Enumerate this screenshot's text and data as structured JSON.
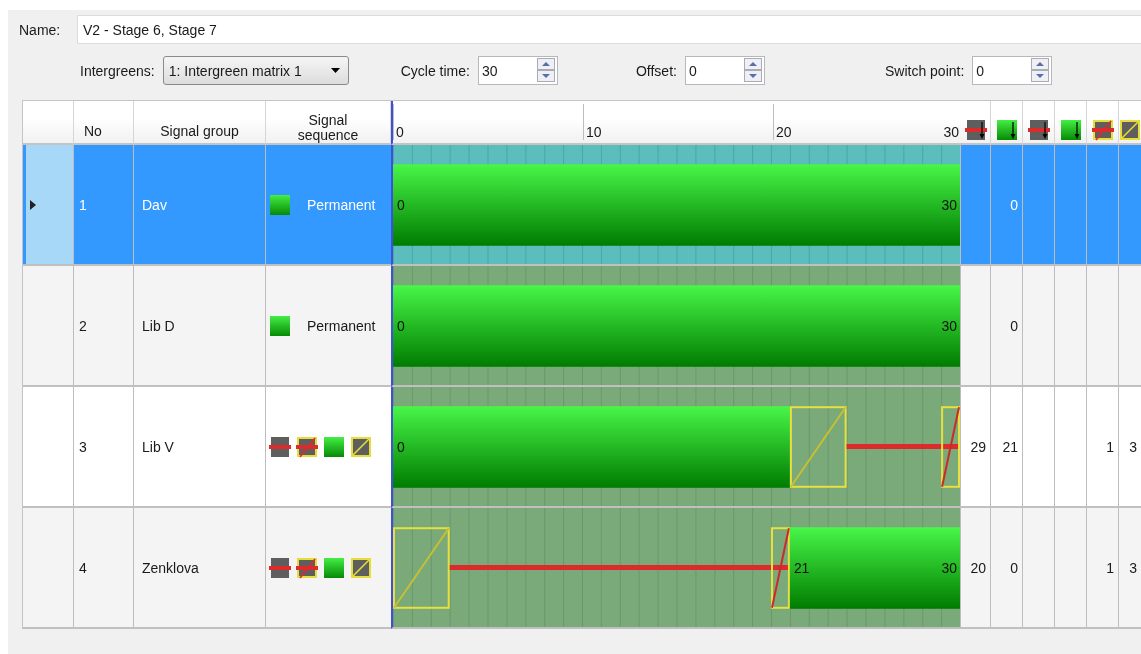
{
  "name_field": {
    "label": "Name:",
    "value": "V2 - Stage 6, Stage 7"
  },
  "controls": [
    {
      "kind": "dropdown",
      "label": "Intergreens:",
      "value": "1: Intergreen matrix 1"
    },
    {
      "kind": "spin",
      "label": "Cycle time:",
      "value": "30"
    },
    {
      "kind": "spin",
      "label": "Offset:",
      "value": "0"
    },
    {
      "kind": "spin",
      "label": "Switch point:",
      "value": "0"
    }
  ],
  "table": {
    "columns": [
      "No",
      "Signal group",
      "Signal sequence"
    ],
    "scale": [
      "0",
      "10",
      "20",
      "30"
    ],
    "extra_columns": [
      {
        "kind": "red-end"
      },
      {
        "kind": "green-end"
      },
      {
        "kind": "red-end"
      },
      {
        "kind": "green-end"
      },
      {
        "kind": "red-amber"
      },
      {
        "kind": "amber"
      }
    ],
    "rows": [
      {
        "no": "1",
        "name": "Dav",
        "selected": true,
        "sequence": {
          "kind": "permanent",
          "label": "Permanent",
          "icons": [
            {
              "kind": "green"
            }
          ]
        },
        "steps": [
          {
            "kind": "green",
            "label_start": "0"
          },
          {
            "kind": "green"
          },
          {
            "kind": "green"
          },
          {
            "kind": "green"
          },
          {
            "kind": "green"
          },
          {
            "kind": "green"
          },
          {
            "kind": "green"
          },
          {
            "kind": "green"
          },
          {
            "kind": "green"
          },
          {
            "kind": "green"
          },
          {
            "kind": "green"
          },
          {
            "kind": "green"
          },
          {
            "kind": "green"
          },
          {
            "kind": "green"
          },
          {
            "kind": "green"
          },
          {
            "kind": "green"
          },
          {
            "kind": "green"
          },
          {
            "kind": "green"
          },
          {
            "kind": "green"
          },
          {
            "kind": "green"
          },
          {
            "kind": "green"
          },
          {
            "kind": "green"
          },
          {
            "kind": "green"
          },
          {
            "kind": "green"
          },
          {
            "kind": "green"
          },
          {
            "kind": "green"
          },
          {
            "kind": "green"
          },
          {
            "kind": "green"
          },
          {
            "kind": "green"
          },
          {
            "kind": "green",
            "label_end": "30"
          }
        ],
        "cells": [
          null,
          "0",
          null,
          null,
          null,
          null
        ]
      },
      {
        "no": "2",
        "name": "Lib D",
        "selected": false,
        "sequence": {
          "kind": "permanent",
          "label": "Permanent",
          "icons": [
            {
              "kind": "green"
            }
          ]
        },
        "steps": [
          {
            "kind": "green",
            "label_start": "0"
          },
          {
            "kind": "green"
          },
          {
            "kind": "green"
          },
          {
            "kind": "green"
          },
          {
            "kind": "green"
          },
          {
            "kind": "green"
          },
          {
            "kind": "green"
          },
          {
            "kind": "green"
          },
          {
            "kind": "green"
          },
          {
            "kind": "green"
          },
          {
            "kind": "green"
          },
          {
            "kind": "green"
          },
          {
            "kind": "green"
          },
          {
            "kind": "green"
          },
          {
            "kind": "green"
          },
          {
            "kind": "green"
          },
          {
            "kind": "green"
          },
          {
            "kind": "green"
          },
          {
            "kind": "green"
          },
          {
            "kind": "green"
          },
          {
            "kind": "green"
          },
          {
            "kind": "green"
          },
          {
            "kind": "green"
          },
          {
            "kind": "green"
          },
          {
            "kind": "green"
          },
          {
            "kind": "green"
          },
          {
            "kind": "green"
          },
          {
            "kind": "green"
          },
          {
            "kind": "green"
          },
          {
            "kind": "green",
            "label_end": "30"
          }
        ],
        "cells": [
          null,
          "0",
          null,
          null,
          null,
          null
        ]
      },
      {
        "no": "3",
        "name": "Lib V",
        "selected": false,
        "sequence": {
          "kind": "phases",
          "icons": [
            {
              "kind": "red"
            },
            {
              "kind": "red-amber"
            },
            {
              "kind": "green"
            },
            {
              "kind": "amber"
            }
          ]
        },
        "steps": [
          {
            "kind": "green",
            "label_start": "0"
          },
          {
            "kind": "green"
          },
          {
            "kind": "green"
          },
          {
            "kind": "green"
          },
          {
            "kind": "green"
          },
          {
            "kind": "green"
          },
          {
            "kind": "green"
          },
          {
            "kind": "green"
          },
          {
            "kind": "green"
          },
          {
            "kind": "green"
          },
          {
            "kind": "green"
          },
          {
            "kind": "green"
          },
          {
            "kind": "green"
          },
          {
            "kind": "green"
          },
          {
            "kind": "green"
          },
          {
            "kind": "green"
          },
          {
            "kind": "green"
          },
          {
            "kind": "green"
          },
          {
            "kind": "green"
          },
          {
            "kind": "green"
          },
          {
            "kind": "green"
          },
          {
            "kind": "amber"
          },
          {
            "kind": "amber"
          },
          {
            "kind": "amber"
          },
          {
            "kind": "red"
          },
          {
            "kind": "red"
          },
          {
            "kind": "red"
          },
          {
            "kind": "red"
          },
          {
            "kind": "red"
          },
          {
            "kind": "red-amber"
          }
        ],
        "cells": [
          "29",
          "21",
          null,
          null,
          "1",
          "3"
        ]
      },
      {
        "no": "4",
        "name": "Zenklova",
        "selected": false,
        "sequence": {
          "kind": "phases",
          "icons": [
            {
              "kind": "red"
            },
            {
              "kind": "red-amber"
            },
            {
              "kind": "green"
            },
            {
              "kind": "amber"
            }
          ]
        },
        "steps": [
          {
            "kind": "amber"
          },
          {
            "kind": "amber"
          },
          {
            "kind": "amber"
          },
          {
            "kind": "red"
          },
          {
            "kind": "red"
          },
          {
            "kind": "red"
          },
          {
            "kind": "red"
          },
          {
            "kind": "red"
          },
          {
            "kind": "red"
          },
          {
            "kind": "red"
          },
          {
            "kind": "red"
          },
          {
            "kind": "red"
          },
          {
            "kind": "red"
          },
          {
            "kind": "red"
          },
          {
            "kind": "red"
          },
          {
            "kind": "red"
          },
          {
            "kind": "red"
          },
          {
            "kind": "red"
          },
          {
            "kind": "red"
          },
          {
            "kind": "red"
          },
          {
            "kind": "red-amber"
          },
          {
            "kind": "green",
            "label_start": "21"
          },
          {
            "kind": "green"
          },
          {
            "kind": "green"
          },
          {
            "kind": "green"
          },
          {
            "kind": "green"
          },
          {
            "kind": "green"
          },
          {
            "kind": "green"
          },
          {
            "kind": "green"
          },
          {
            "kind": "green",
            "label_end": "30"
          }
        ],
        "cells": [
          "20",
          "0",
          null,
          null,
          "1",
          "3"
        ]
      }
    ]
  }
}
